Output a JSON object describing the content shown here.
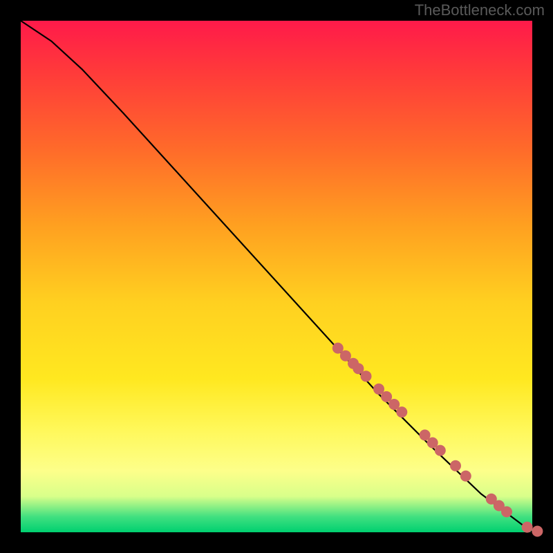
{
  "watermark": "TheBottleneck.com",
  "chart_data": {
    "type": "line",
    "title": "",
    "xlabel": "",
    "ylabel": "",
    "xlim": [
      0,
      100
    ],
    "ylim": [
      0,
      100
    ],
    "grid": false,
    "curve": {
      "name": "curve",
      "color": "#000000",
      "points": [
        {
          "x": 0,
          "y": 100
        },
        {
          "x": 6,
          "y": 96
        },
        {
          "x": 12,
          "y": 90.5
        },
        {
          "x": 20,
          "y": 82
        },
        {
          "x": 30,
          "y": 71
        },
        {
          "x": 40,
          "y": 60
        },
        {
          "x": 50,
          "y": 49
        },
        {
          "x": 60,
          "y": 38
        },
        {
          "x": 70,
          "y": 27
        },
        {
          "x": 80,
          "y": 17
        },
        {
          "x": 90,
          "y": 7.5
        },
        {
          "x": 100,
          "y": 0
        }
      ]
    },
    "markers": {
      "name": "markers",
      "color": "#cc6666",
      "radius": 8,
      "points": [
        {
          "x": 62,
          "y": 36
        },
        {
          "x": 63.5,
          "y": 34.5
        },
        {
          "x": 65,
          "y": 33
        },
        {
          "x": 66,
          "y": 32
        },
        {
          "x": 67.5,
          "y": 30.5
        },
        {
          "x": 70,
          "y": 28
        },
        {
          "x": 71.5,
          "y": 26.5
        },
        {
          "x": 73,
          "y": 25
        },
        {
          "x": 74.5,
          "y": 23.5
        },
        {
          "x": 79,
          "y": 19
        },
        {
          "x": 80.5,
          "y": 17.5
        },
        {
          "x": 82,
          "y": 16
        },
        {
          "x": 85,
          "y": 13
        },
        {
          "x": 87,
          "y": 11
        },
        {
          "x": 92,
          "y": 6.5
        },
        {
          "x": 93.5,
          "y": 5.2
        },
        {
          "x": 95,
          "y": 4
        },
        {
          "x": 99,
          "y": 1
        },
        {
          "x": 101,
          "y": 0.2
        }
      ]
    }
  }
}
